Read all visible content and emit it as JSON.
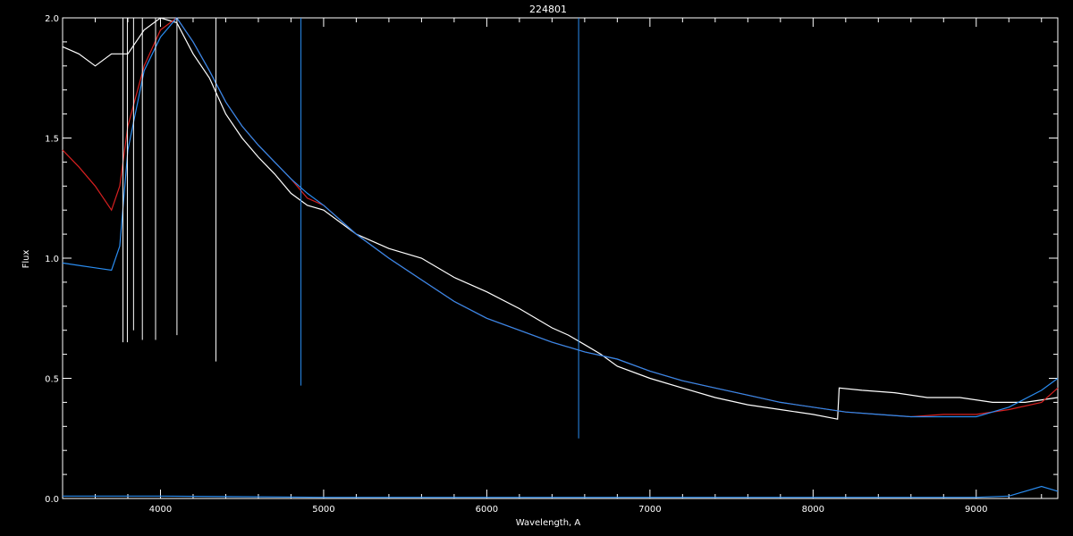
{
  "chart_data": {
    "type": "line",
    "title": "224801",
    "xlabel": "Wavelength, A",
    "ylabel": "Flux",
    "xlim": [
      3400,
      9500
    ],
    "ylim": [
      0.0,
      2.0
    ],
    "x_ticks": [
      4000,
      5000,
      6000,
      7000,
      8000,
      9000
    ],
    "x_tick_labels": [
      "4000",
      "5000",
      "6000",
      "7000",
      "8000",
      "9000"
    ],
    "y_ticks": [
      0.0,
      0.5,
      1.0,
      1.5,
      2.0
    ],
    "y_tick_labels": [
      "0.0",
      "0.5",
      "1.0",
      "1.5",
      "2.0"
    ],
    "grid": false,
    "series": [
      {
        "color": "#ffffff",
        "x": [
          3400,
          3500,
          3600,
          3700,
          3800,
          3900,
          4000,
          4100,
          4200,
          4300,
          4400,
          4500,
          4600,
          4700,
          4800,
          4900,
          5000,
          5200,
          5400,
          5600,
          5800,
          6000,
          6200,
          6400,
          6500,
          6600,
          6700,
          6800,
          7000,
          7200,
          7400,
          7600,
          7800,
          8000,
          8150,
          8160,
          8300,
          8500,
          8700,
          8900,
          9100,
          9300,
          9500
        ],
        "y": [
          1.88,
          1.85,
          1.8,
          1.85,
          1.85,
          1.95,
          2.0,
          1.98,
          1.85,
          1.75,
          1.6,
          1.5,
          1.42,
          1.35,
          1.27,
          1.22,
          1.2,
          1.1,
          1.04,
          1.0,
          0.92,
          0.86,
          0.79,
          0.71,
          0.68,
          0.64,
          0.6,
          0.55,
          0.5,
          0.46,
          0.42,
          0.39,
          0.37,
          0.35,
          0.33,
          0.46,
          0.45,
          0.44,
          0.42,
          0.42,
          0.4,
          0.4,
          0.42
        ]
      },
      {
        "color": "#d62020",
        "x": [
          3400,
          3500,
          3600,
          3700,
          3750,
          3800,
          3900,
          4000,
          4100,
          4200,
          4300,
          4400,
          4500,
          4600,
          4700,
          4800,
          4900,
          5000,
          5200,
          5400,
          5600,
          5800,
          6000,
          6200,
          6400,
          6600,
          6800,
          7000,
          7200,
          7400,
          7600,
          7800,
          8000,
          8200,
          8400,
          8600,
          8800,
          9000,
          9200,
          9400,
          9500
        ],
        "y": [
          1.45,
          1.38,
          1.3,
          1.2,
          1.3,
          1.55,
          1.8,
          1.95,
          2.0,
          1.9,
          1.78,
          1.65,
          1.55,
          1.47,
          1.4,
          1.33,
          1.25,
          1.22,
          1.1,
          1.0,
          0.91,
          0.82,
          0.75,
          0.7,
          0.65,
          0.61,
          0.58,
          0.53,
          0.49,
          0.46,
          0.43,
          0.4,
          0.38,
          0.36,
          0.35,
          0.34,
          0.35,
          0.35,
          0.37,
          0.4,
          0.46
        ]
      },
      {
        "color": "#2a8cf0",
        "x": [
          3400,
          3500,
          3600,
          3700,
          3750,
          3800,
          3900,
          4000,
          4100,
          4200,
          4300,
          4400,
          4500,
          4600,
          4700,
          4800,
          4900,
          5000,
          5200,
          5400,
          5600,
          5800,
          6000,
          6200,
          6400,
          6600,
          6800,
          7000,
          7200,
          7400,
          7600,
          7800,
          8000,
          8200,
          8400,
          8600,
          8800,
          9000,
          9200,
          9400,
          9500
        ],
        "y": [
          0.98,
          0.97,
          0.96,
          0.95,
          1.05,
          1.45,
          1.78,
          1.92,
          2.0,
          1.9,
          1.78,
          1.65,
          1.55,
          1.47,
          1.4,
          1.33,
          1.27,
          1.22,
          1.1,
          1.0,
          0.91,
          0.82,
          0.75,
          0.7,
          0.65,
          0.61,
          0.58,
          0.53,
          0.49,
          0.46,
          0.43,
          0.4,
          0.38,
          0.36,
          0.35,
          0.34,
          0.34,
          0.34,
          0.38,
          0.45,
          0.5
        ]
      },
      {
        "color": "#2a8cf0",
        "x": [
          3400,
          4000,
          5000,
          6000,
          7000,
          8000,
          9000,
          9200,
          9400,
          9500
        ],
        "y": [
          0.01,
          0.01,
          0.005,
          0.005,
          0.005,
          0.005,
          0.005,
          0.01,
          0.05,
          0.03
        ]
      }
    ],
    "absorption_lines": [
      {
        "x": 3770,
        "depth": 0.65,
        "color": "#ffffff"
      },
      {
        "x": 3797,
        "depth": 0.65,
        "color": "#ffffff"
      },
      {
        "x": 3835,
        "depth": 0.7,
        "color": "#ffffff"
      },
      {
        "x": 3889,
        "depth": 0.66,
        "color": "#ffffff"
      },
      {
        "x": 3970,
        "depth": 0.66,
        "color": "#ffffff"
      },
      {
        "x": 4101,
        "depth": 0.68,
        "color": "#ffffff"
      },
      {
        "x": 4340,
        "depth": 0.57,
        "color": "#ffffff"
      },
      {
        "x": 4861,
        "depth": 0.47,
        "color": "#2a8cf0"
      },
      {
        "x": 6563,
        "depth": 0.25,
        "color": "#2a8cf0"
      }
    ]
  }
}
